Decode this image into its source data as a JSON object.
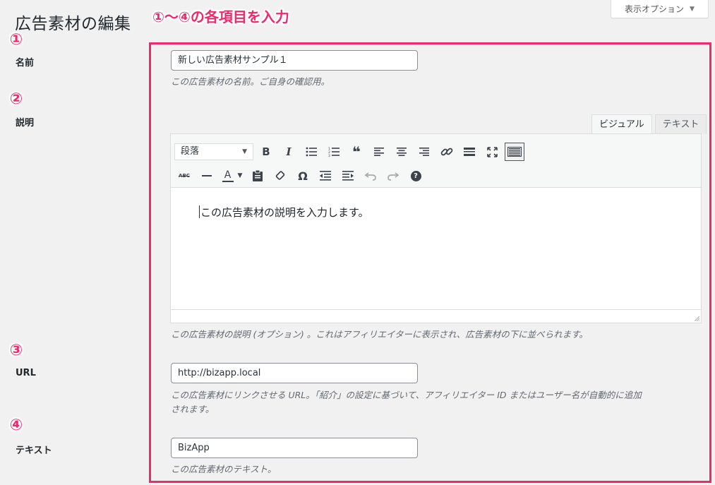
{
  "page": {
    "title": "広告素材の編集",
    "annotation": "①〜④の各項目を入力",
    "screen_options": "表示オプション"
  },
  "markers": [
    "①",
    "②",
    "③",
    "④"
  ],
  "fields": {
    "name": {
      "label": "名前",
      "value": "新しい広告素材サンプル１",
      "description": "この広告素材の名前。ご自身の確認用。"
    },
    "description": {
      "label": "説明",
      "tab_visual": "ビジュアル",
      "tab_text": "テキスト",
      "format_select": "段落",
      "content": "この広告素材の説明を入力します。",
      "help": "この広告素材の説明 (オプション) 。これはアフィリエイターに表示され、広告素材の下に並べられます。"
    },
    "url": {
      "label": "URL",
      "value": "http://bizapp.local",
      "description_line1": "この広告素材にリンクさせる URL。「紹介」の設定に基づいて、アフィリエイター ID またはユーザー名が自動的に追加",
      "description_line2": "されます。"
    },
    "text": {
      "label": "テキスト",
      "value": "BizApp",
      "description": "この広告素材のテキスト。"
    }
  },
  "toolbar": {
    "bold": "B",
    "italic": "I",
    "quote": "❝",
    "strikethrough": "ABC",
    "text_color": "A",
    "special_char": "Ω",
    "help": "?"
  },
  "colors": {
    "accent": "#ee2a6a",
    "background": "#f1f1f1"
  }
}
